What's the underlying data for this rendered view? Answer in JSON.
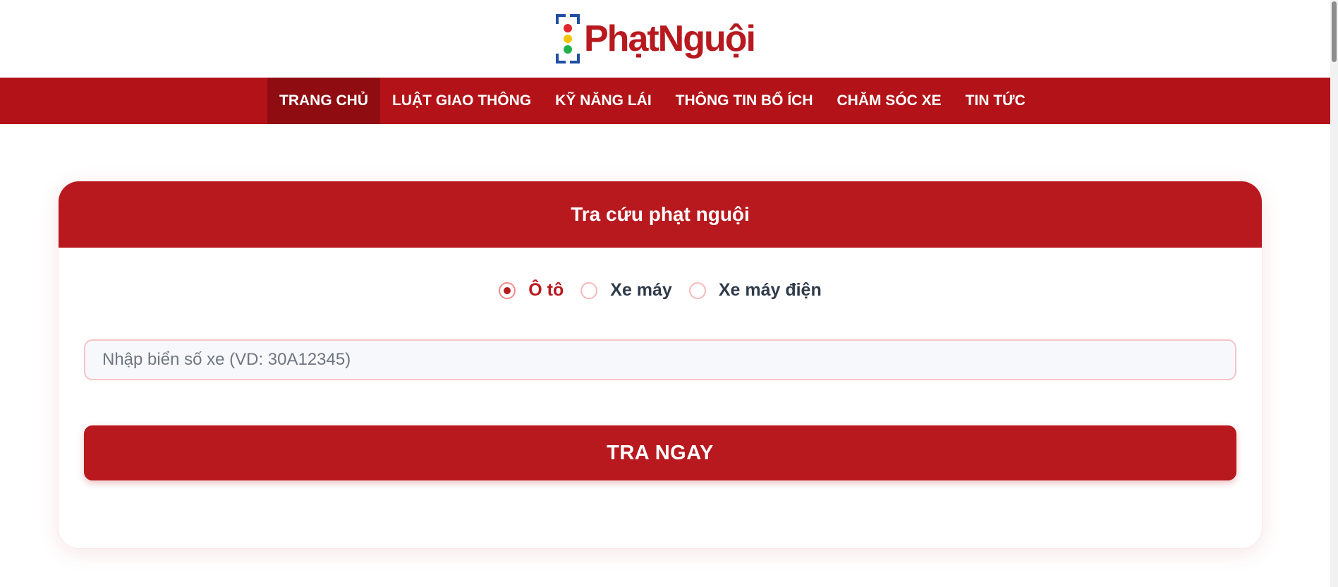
{
  "colors": {
    "brand_red": "#b8191e",
    "nav_red": "#b31318",
    "nav_active": "#8f0d11",
    "logo_blue": "#1f4ea3",
    "light_red": "#e2262c",
    "light_yellow": "#f5c400",
    "light_green": "#21b14a"
  },
  "logo": {
    "text": "PhạtNguội",
    "icon": "traffic-light-icon"
  },
  "nav": {
    "items": [
      {
        "label": "TRANG CHỦ",
        "active": true
      },
      {
        "label": "LUẬT GIAO THÔNG",
        "active": false
      },
      {
        "label": "KỸ NĂNG LÁI",
        "active": false
      },
      {
        "label": "THÔNG TIN BỔ ÍCH",
        "active": false
      },
      {
        "label": "CHĂM SÓC XE",
        "active": false
      },
      {
        "label": "TIN TỨC",
        "active": false
      }
    ]
  },
  "lookup": {
    "title": "Tra cứu phạt nguội",
    "vehicle_types": [
      {
        "label": "Ô tô",
        "selected": true
      },
      {
        "label": "Xe máy",
        "selected": false
      },
      {
        "label": "Xe máy điện",
        "selected": false
      }
    ],
    "plate_placeholder": "Nhập biển số xe (VD: 30A12345)",
    "plate_value": "",
    "submit_label": "TRA NGAY"
  }
}
